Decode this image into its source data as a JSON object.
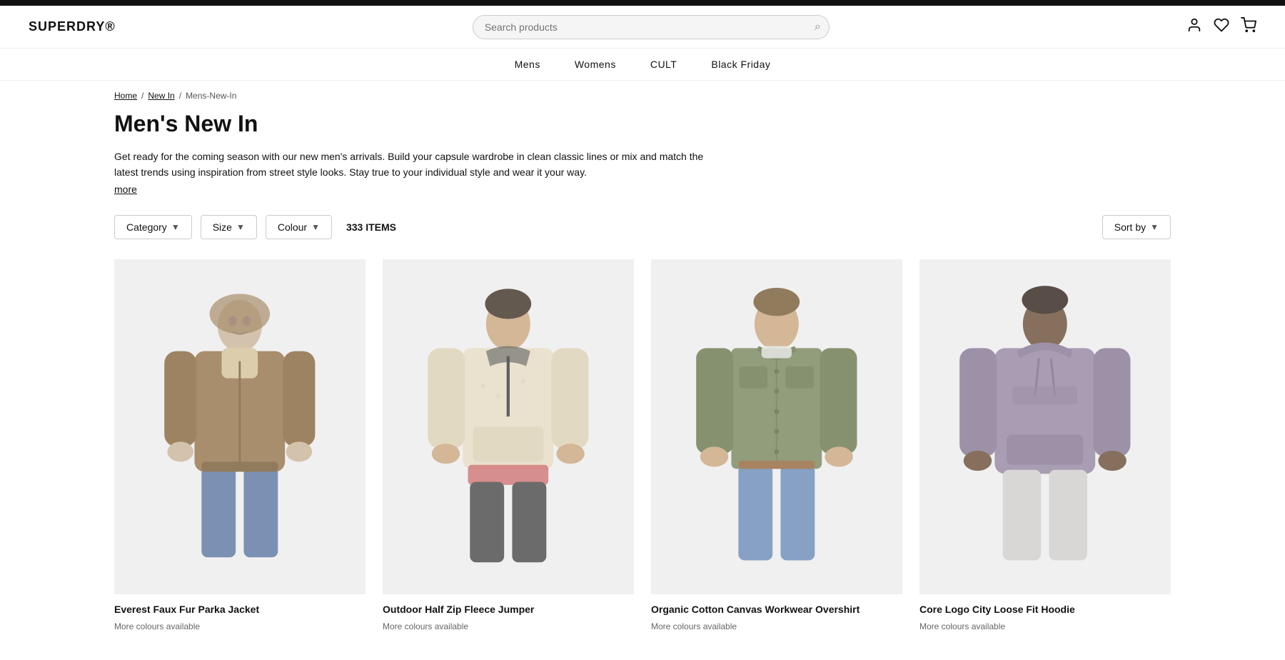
{
  "topbar": {},
  "header": {
    "logo": "SUPERDRY®",
    "search": {
      "placeholder": "Search products"
    },
    "icons": {
      "account": "👤",
      "wishlist": "♡",
      "cart": "🛒"
    }
  },
  "nav": {
    "items": [
      {
        "id": "mens",
        "label": "Mens"
      },
      {
        "id": "womens",
        "label": "Womens"
      },
      {
        "id": "cult",
        "label": "CULT"
      },
      {
        "id": "black-friday",
        "label": "Black Friday"
      }
    ]
  },
  "breadcrumb": {
    "items": [
      {
        "label": "Home",
        "href": "#"
      },
      {
        "label": "New In",
        "href": "#"
      },
      {
        "label": "Mens-New-In",
        "href": null
      }
    ]
  },
  "page": {
    "title": "Men's New In",
    "description": "Get ready for the coming season with our new men's arrivals. Build your capsule wardrobe in clean classic lines or mix and match the latest trends using inspiration from street style looks. Stay true to your individual style and wear it your way.",
    "more_label": "more",
    "items_count": "333 ITEMS"
  },
  "filters": {
    "category_label": "Category",
    "size_label": "Size",
    "colour_label": "Colour",
    "sort_label": "Sort by"
  },
  "products": [
    {
      "id": "product-1",
      "name": "Everest Faux Fur Parka Jacket",
      "subtitle": "More colours available",
      "img_class": "product-img-1"
    },
    {
      "id": "product-2",
      "name": "Outdoor Half Zip Fleece Jumper",
      "subtitle": "More colours available",
      "img_class": "product-img-2"
    },
    {
      "id": "product-3",
      "name": "Organic Cotton Canvas Workwear Overshirt",
      "subtitle": "More colours available",
      "img_class": "product-img-3"
    },
    {
      "id": "product-4",
      "name": "Core Logo City Loose Fit Hoodie",
      "subtitle": "More colours available",
      "img_class": "product-img-4"
    }
  ]
}
